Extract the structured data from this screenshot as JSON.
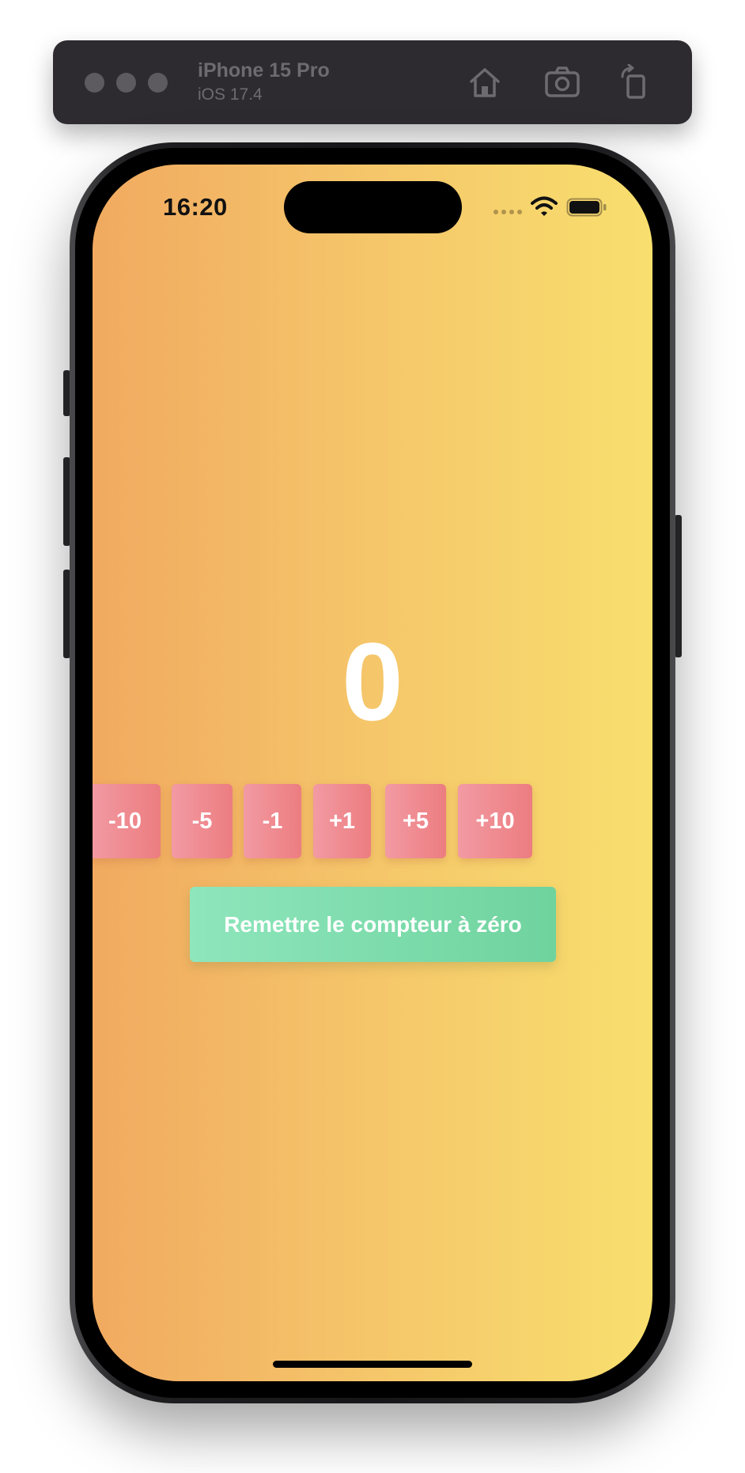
{
  "simulator": {
    "device_name": "iPhone 15 Pro",
    "os_version": "iOS 17.4",
    "icons": [
      "home-icon",
      "screenshot-camera-icon",
      "rotate-icon"
    ]
  },
  "status_bar": {
    "time": "16:20",
    "icons": [
      "signal-dots-icon",
      "wifi-icon",
      "battery-icon"
    ]
  },
  "app": {
    "counter_value": "0",
    "step_buttons": [
      "-10",
      "-5",
      "-1",
      "+1",
      "+5",
      "+10"
    ],
    "reset_label": "Remettre le compteur à zéro"
  },
  "colors": {
    "background_gradient": [
      "#f1aa60",
      "#f8df6e"
    ],
    "step_button_gradient": [
      "#f29aa3",
      "#ec7d80"
    ],
    "reset_button_gradient": [
      "#8ee6bc",
      "#6fd39e"
    ],
    "text": "#ffffff"
  }
}
